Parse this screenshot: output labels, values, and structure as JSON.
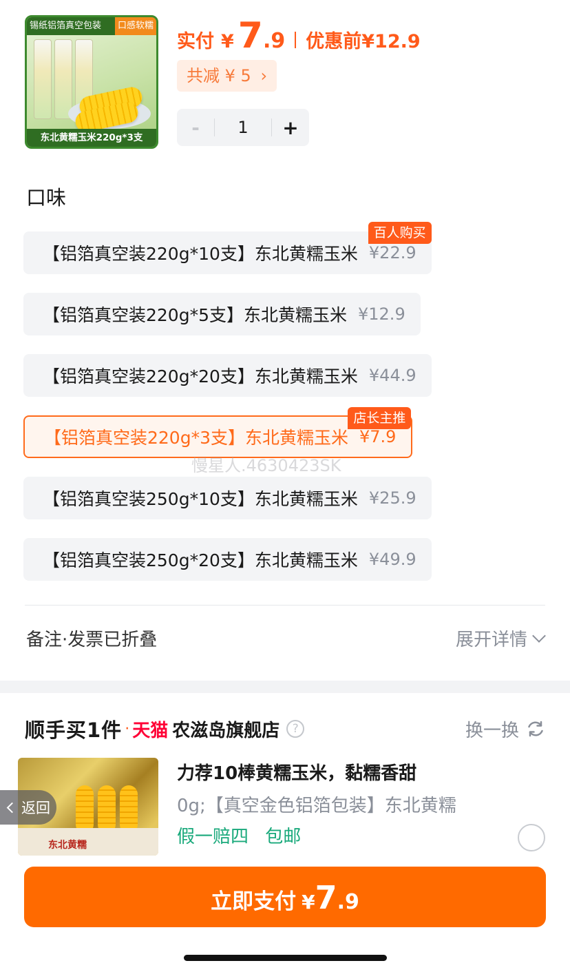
{
  "product": {
    "thumb_banner_left": "锡纸铝箔真空包装",
    "thumb_banner_right": "口感软糯",
    "thumb_caption": "东北黄糯玉米220g*3支",
    "price_label": "实付",
    "currency": "¥",
    "price_int": "7",
    "price_dec": ".9",
    "before_label": "优惠前",
    "before_price": "¥12.9",
    "discount_text": "共减 ¥ 5",
    "discount_chevron": "›",
    "quantity": "1",
    "qty_minus": "-",
    "qty_plus": "+"
  },
  "flavor": {
    "title": "口味",
    "options": [
      {
        "name": "【铝箔真空装220g*10支】东北黄糯玉米",
        "price": "¥22.9",
        "badge": "百人购买",
        "selected": false
      },
      {
        "name": "【铝箔真空装220g*5支】东北黄糯玉米",
        "price": "¥12.9",
        "badge": "",
        "selected": false
      },
      {
        "name": "【铝箔真空装220g*20支】东北黄糯玉米",
        "price": "¥44.9",
        "badge": "",
        "selected": false
      },
      {
        "name": "【铝箔真空装220g*3支】东北黄糯玉米",
        "price": "¥7.9",
        "badge": "店长主推",
        "selected": true
      },
      {
        "name": "【铝箔真空装250g*10支】东北黄糯玉米",
        "price": "¥25.9",
        "badge": "",
        "selected": false
      },
      {
        "name": "【铝箔真空装250g*20支】东北黄糯玉米",
        "price": "¥49.9",
        "badge": "",
        "selected": false
      }
    ]
  },
  "watermark": "慢星人.4630423SK",
  "notes": {
    "label": "备注·发票已折叠",
    "expand_label": "展开详情"
  },
  "addon": {
    "title": "顺手买1件",
    "dot": "·",
    "platform": "天猫",
    "store": "农滋岛旗舰店",
    "help": "?",
    "swap_label": "换一换",
    "image_label": "东北黄糯",
    "name": "力荐10棒黄糯玉米，黏糯香甜",
    "desc": "0g;【真空金色铝箔包装】东北黄糯",
    "tags": [
      "假一赔四",
      "包邮"
    ]
  },
  "back_label": "返回",
  "pay": {
    "label": "立即支付",
    "currency": "¥",
    "amount_int": "7",
    "amount_dec": ".9"
  },
  "colors": {
    "accent": "#ff6a00",
    "price": "#ff5a1a",
    "tmall": "#ff0036",
    "tag_green": "#19a97b"
  }
}
